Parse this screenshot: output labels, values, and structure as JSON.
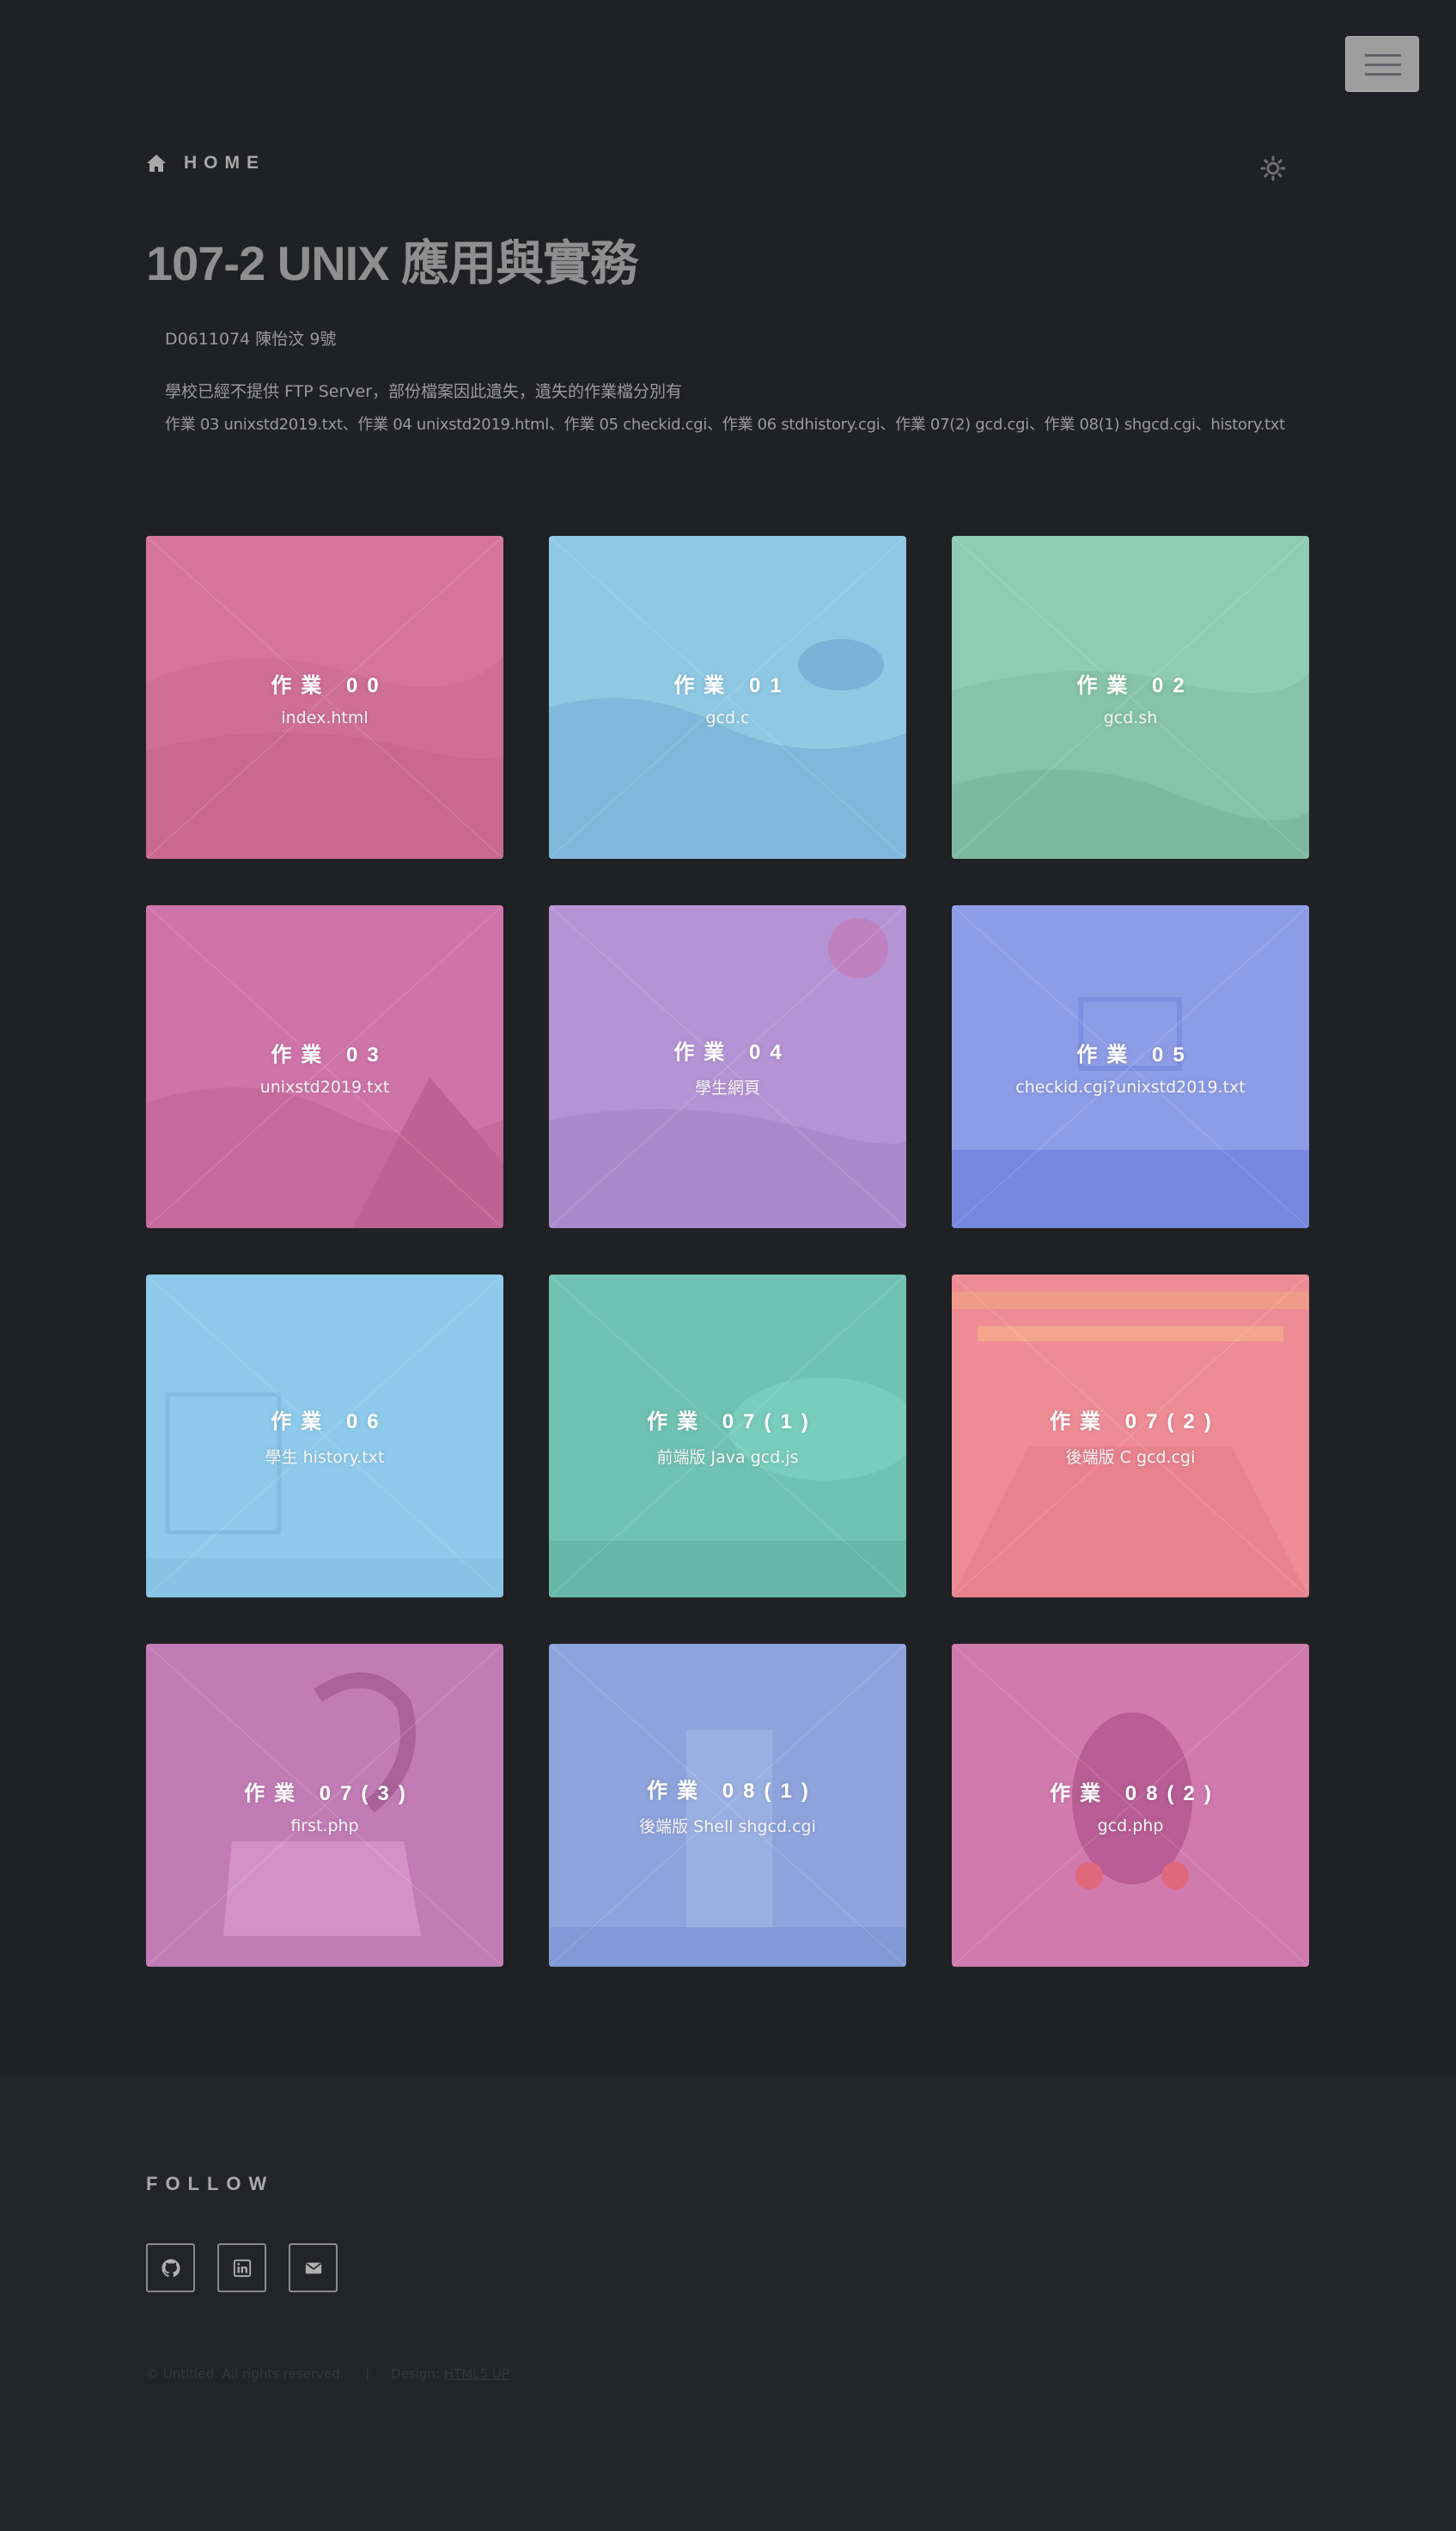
{
  "nav": {
    "home_label": "HOME",
    "menu_icon": "hamburger-icon",
    "theme_icon": "sun-icon"
  },
  "header": {
    "title": "107-2 UNIX 應用與實務",
    "student": "D0611074 陳怡汶 9號",
    "notice": "學校已經不提供 FTP Server，部份檔案因此遺失，遺失的作業檔分別有",
    "missing": "作業 03 unixstd2019.txt、作業 04 unixstd2019.html、作業 05 checkid.cgi、作業 06 stdhistory.cgi、作業 07(2) gcd.cgi、作業 08(1) shgcd.cgi、history.txt"
  },
  "cards": [
    {
      "title": "作業 00",
      "file": "index.html",
      "color": "#d6759c"
    },
    {
      "title": "作業 01",
      "file": "gcd.c",
      "color": "#8fc8e3"
    },
    {
      "title": "作業 02",
      "file": "gcd.sh",
      "color": "#8fcdb3"
    },
    {
      "title": "作業 03",
      "file": "unixstd2019.txt",
      "color": "#cf74a8"
    },
    {
      "title": "作業 04",
      "file": "學生網頁",
      "color": "#b594d5"
    },
    {
      "title": "作業 05",
      "file": "checkid.cgi?unixstd2019.txt",
      "color": "#8d9ce6"
    },
    {
      "title": "作業 06",
      "file": "學生 history.txt",
      "color": "#8ecaeb"
    },
    {
      "title": "作業 07(1)",
      "file": "前端版 Java gcd.js",
      "color": "#70c2b4"
    },
    {
      "title": "作業 07(2)",
      "file": "後端版 C gcd.cgi",
      "color": "#ee8c96"
    },
    {
      "title": "作業 07(3)",
      "file": "first.php",
      "color": "#c27cb5"
    },
    {
      "title": "作業 08(1)",
      "file": "後端版 Shell shgcd.cgi",
      "color": "#8ea3dc"
    },
    {
      "title": "作業 08(2)",
      "file": "gcd.php",
      "color": "#d07aae"
    }
  ],
  "footer": {
    "follow": "FOLLOW",
    "social": [
      {
        "name": "GitHub",
        "icon": "github-icon"
      },
      {
        "name": "LinkedIn",
        "icon": "linkedin-icon"
      },
      {
        "name": "Email",
        "icon": "envelope-icon"
      }
    ],
    "copyright": "© Untitled. All rights reserved.",
    "design_prefix": "Design:",
    "design_link": "HTML5 UP"
  }
}
